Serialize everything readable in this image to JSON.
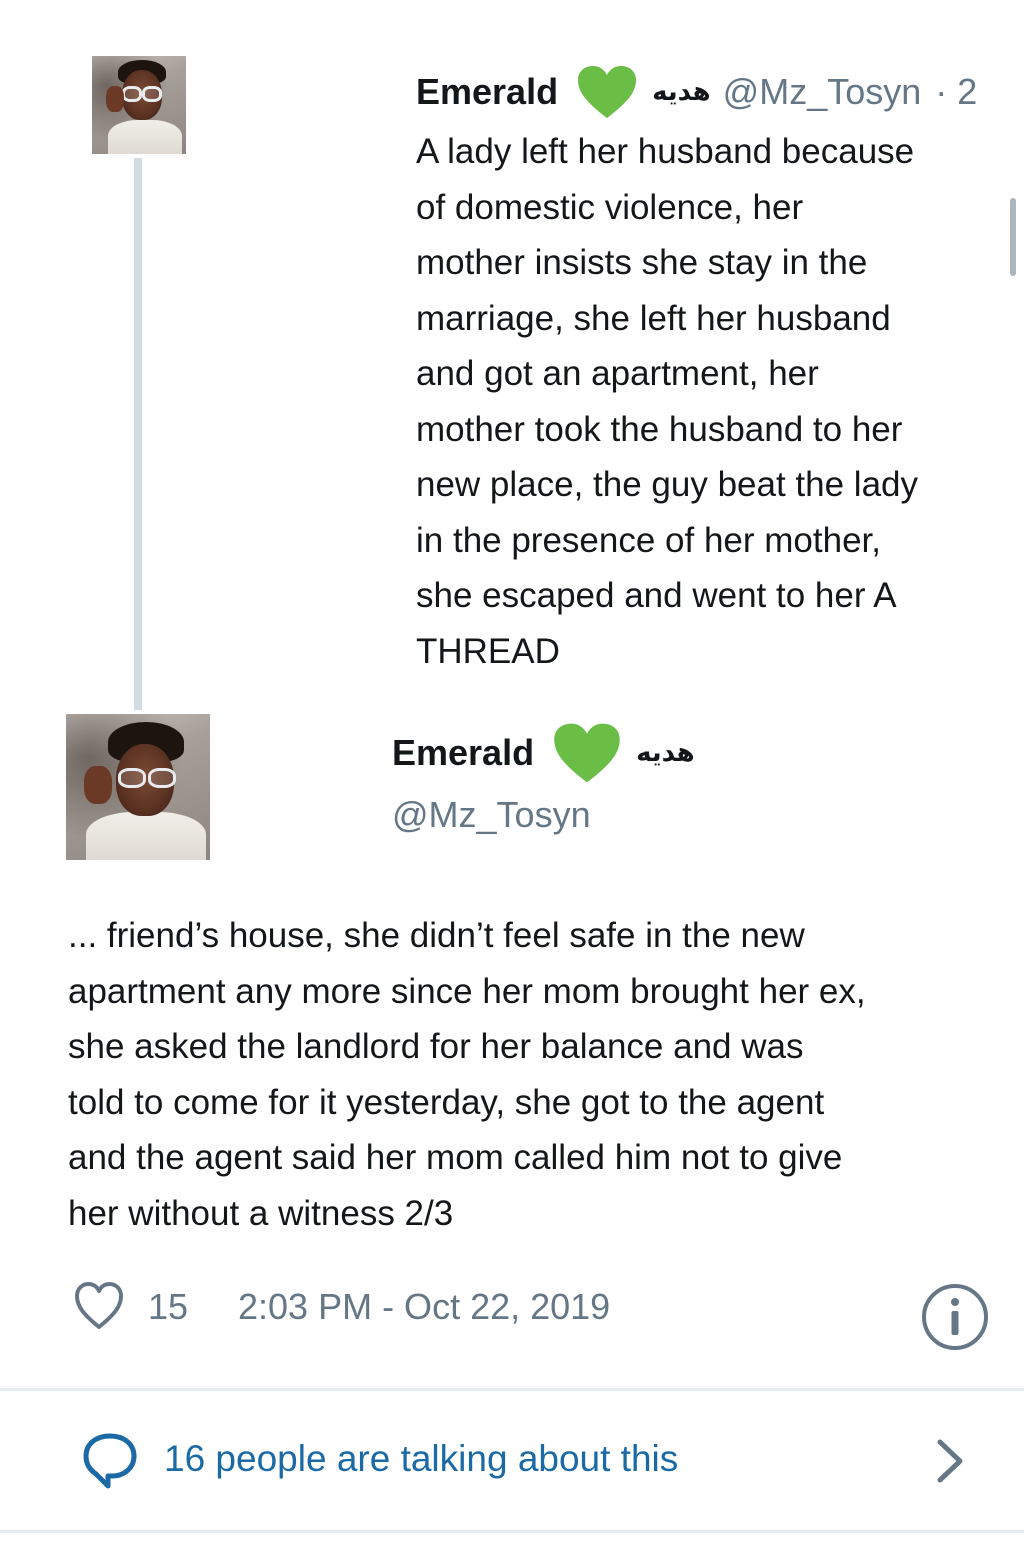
{
  "colors": {
    "text": "#14171a",
    "muted": "#657786",
    "verified_heart": "#6abd45",
    "link": "#1b6aa5",
    "divider": "#e6ecf0",
    "thread_line": "#d3dce3"
  },
  "tweet1": {
    "name": "Emerald",
    "arabic_name": "هديه",
    "handle": "@Mz_Tosyn",
    "time_prefix": "· 2",
    "verified_icon": "green-heart-icon",
    "body": "A lady left her husband because\nof domestic violence, her\nmother insists she stay in the\nmarriage, she left her husband\nand got an apartment, her\nmother took the husband to her\nnew place, the guy beat the lady\nin the presence of her mother,\nshe escaped and went to her  A\nTHREAD"
  },
  "tweet2": {
    "name": "Emerald",
    "arabic_name": "هديه",
    "handle": "@Mz_Tosyn",
    "verified_icon": "green-heart-icon",
    "body": "... friend’s house, she didn’t feel safe in the new\napartment any more since her mom brought her ex,\nshe asked the landlord for her balance and was\ntold to come for it yesterday, she got to the agent\nand the agent said her mom called him not to give\nher without a witness 2/3",
    "like_count": "15",
    "timestamp": "2:03 PM - Oct 22, 2019"
  },
  "talking": {
    "text": "16 people are talking about this"
  },
  "icons": {
    "like": "heart-outline-icon",
    "info": "info-icon",
    "comment": "speech-bubble-icon",
    "chevron": "chevron-right-icon"
  }
}
